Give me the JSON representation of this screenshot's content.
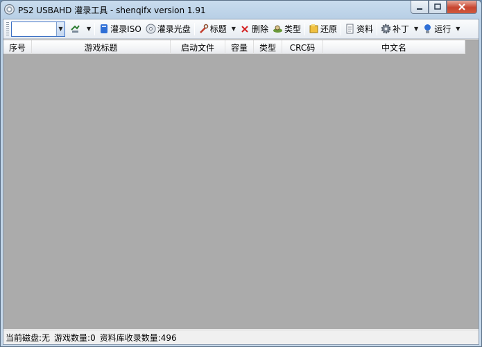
{
  "window": {
    "title": "PS2 USBAHD 灌录工具 - shenqifx version 1.91",
    "minimize_icon": "minimize-icon",
    "maximize_icon": "maximize-icon",
    "close_icon": "close-icon"
  },
  "toolbar": {
    "drive_value": "",
    "items": [
      {
        "label": "",
        "icon": "drive-refresh-icon",
        "dropdown": true
      },
      {
        "label": "灌录ISO",
        "icon": "burn-iso-icon"
      },
      {
        "label": "灌录光盘",
        "icon": "burn-disc-icon"
      },
      {
        "label": "标题",
        "icon": "wrench-icon",
        "dropdown": true
      },
      {
        "label": "删除",
        "icon": "delete-icon"
      },
      {
        "label": "类型",
        "icon": "type-icon"
      },
      {
        "label": "还原",
        "icon": "restore-icon"
      },
      {
        "label": "资料",
        "icon": "info-icon"
      },
      {
        "label": "补丁",
        "icon": "patch-gear-icon",
        "dropdown": true
      },
      {
        "label": "运行",
        "icon": "run-icon",
        "dropdown": true
      }
    ]
  },
  "listview": {
    "columns": [
      "序号",
      "游戏标题",
      "启动文件",
      "容量",
      "类型",
      "CRC码",
      "中文名"
    ],
    "rows": []
  },
  "statusbar": {
    "current_disk": "当前磁盘:无",
    "game_count": "游戏数量:0",
    "db_count": "资料库收录数量:496"
  }
}
